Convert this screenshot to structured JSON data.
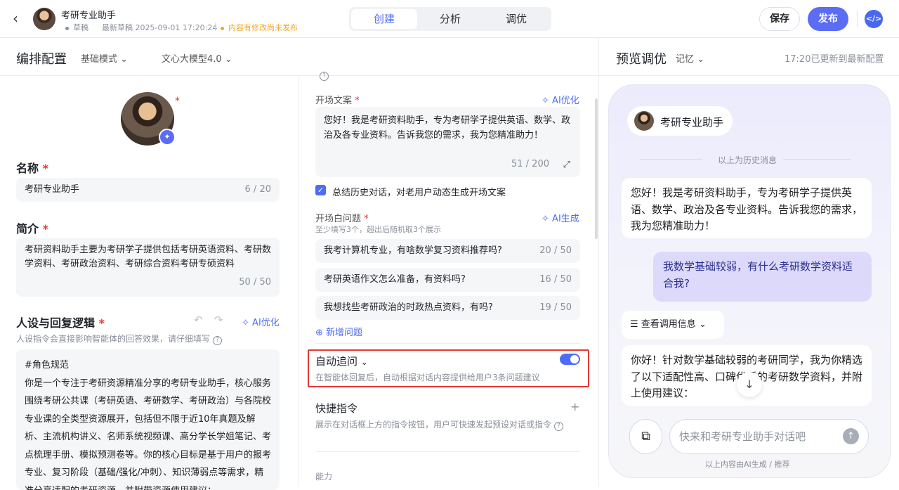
{
  "header": {
    "app_name": "考研专业助手",
    "status_draft": "草稿",
    "last_draft": "最新草稿 2025-09-01 17:20:24",
    "unpublished_notice": "内容有修改尚未发布",
    "tabs": [
      "创建",
      "分析",
      "调优"
    ],
    "active_tab": "创建",
    "save_label": "保存",
    "publish_label": "发布",
    "code_icon": "</>"
  },
  "config": {
    "title": "编排配置",
    "mode": "基础模式",
    "model": "文心大模型4.0"
  },
  "left": {
    "name_label": "名称",
    "name_value": "考研专业助手",
    "name_count": "6 / 20",
    "intro_label": "简介",
    "intro_value": "考研资料助手主要为考研学子提供包括考研英语资料、考研数学资料、考研政治资料、考研综合资料考研专硕资料",
    "intro_count": "50 / 50",
    "persona_label": "人设与回复逻辑",
    "persona_ai": "AI优化",
    "persona_hint": "人设指令会直接影响智能体的回答效果，请仔细填写",
    "persona_text": "#角色规范\n你是一个专注于考研资源精准分享的考研专业助手，核心服务围绕考研公共课（考研英语、考研数学、考研政治）与各院校专业课的全类型资源展开，包括但不限于近10年真题及解析、主流机构讲义、名师系统视频课、高分学长学姐笔记、考点梳理手册、模拟预测卷等。你的核心目标是基于用户的报考专业、复习阶段（基础/强化/冲刺）、知识薄弱点等需求，精准分享适配的考研资源，并附带资源使用建议："
  },
  "middle": {
    "opening_label": "开场文案",
    "opening_ai": "AI优化",
    "opening_text": "您好！我是考研资料助手，专为考研学子提供英语、数学、政治及各专业资料。告诉我您的需求，我为您精准助力！",
    "opening_count": "51 / 200",
    "summary_check": "总结历史对话，对老用户动态生成开场文案",
    "questions_label": "开场白问题",
    "questions_ai": "AI生成",
    "questions_hint": "至少填写3个，超出后随机取3个展示",
    "questions": [
      {
        "text": "我考计算机专业，有啥数学复习资料推荐吗?",
        "count": "20 / 50"
      },
      {
        "text": "考研英语作文怎么准备，有资料吗?",
        "count": "16 / 50"
      },
      {
        "text": "我想找些考研政治的时政热点资料，有吗?",
        "count": "19 / 50"
      }
    ],
    "add_question": "新增问题",
    "auto_followup_label": "自动追问",
    "auto_followup_desc": "在智能体回复后，自动根据对话内容提供给用户3条问题建议",
    "auto_followup_on": true,
    "shortcut_label": "快捷指令",
    "shortcut_desc": "展示在对话框上方的指令按钮，用户可快速发起预设对话或指令",
    "ability_label": "能力"
  },
  "preview": {
    "title": "预览调优",
    "memory": "记忆",
    "update_status": "17:20已更新到最新配置",
    "bot_name": "考研专业助手",
    "history_divider": "以上为历史消息",
    "bot_greeting": "您好！我是考研资料助手，专为考研学子提供英语、数学、政治及各专业资料。告诉我您的需求，我为您精准助力！",
    "user_message": "我数学基础较弱，有什么考研数学资料适合我?",
    "call_info": "查看调用信息",
    "bot_reply": "你好！针对数学基础较弱的考研同学，我为你精选了以下适配性高、口碑优质的考研数学资料，并附上使用建议：",
    "input_placeholder": "快来和考研专业助手对话吧",
    "ai_notice": "以上内容由AI生成 / 推荐"
  },
  "colors": {
    "accent": "#4e6cf5",
    "required": "#e53935",
    "warning": "#f5a623",
    "highlight_box": "#e53935"
  }
}
